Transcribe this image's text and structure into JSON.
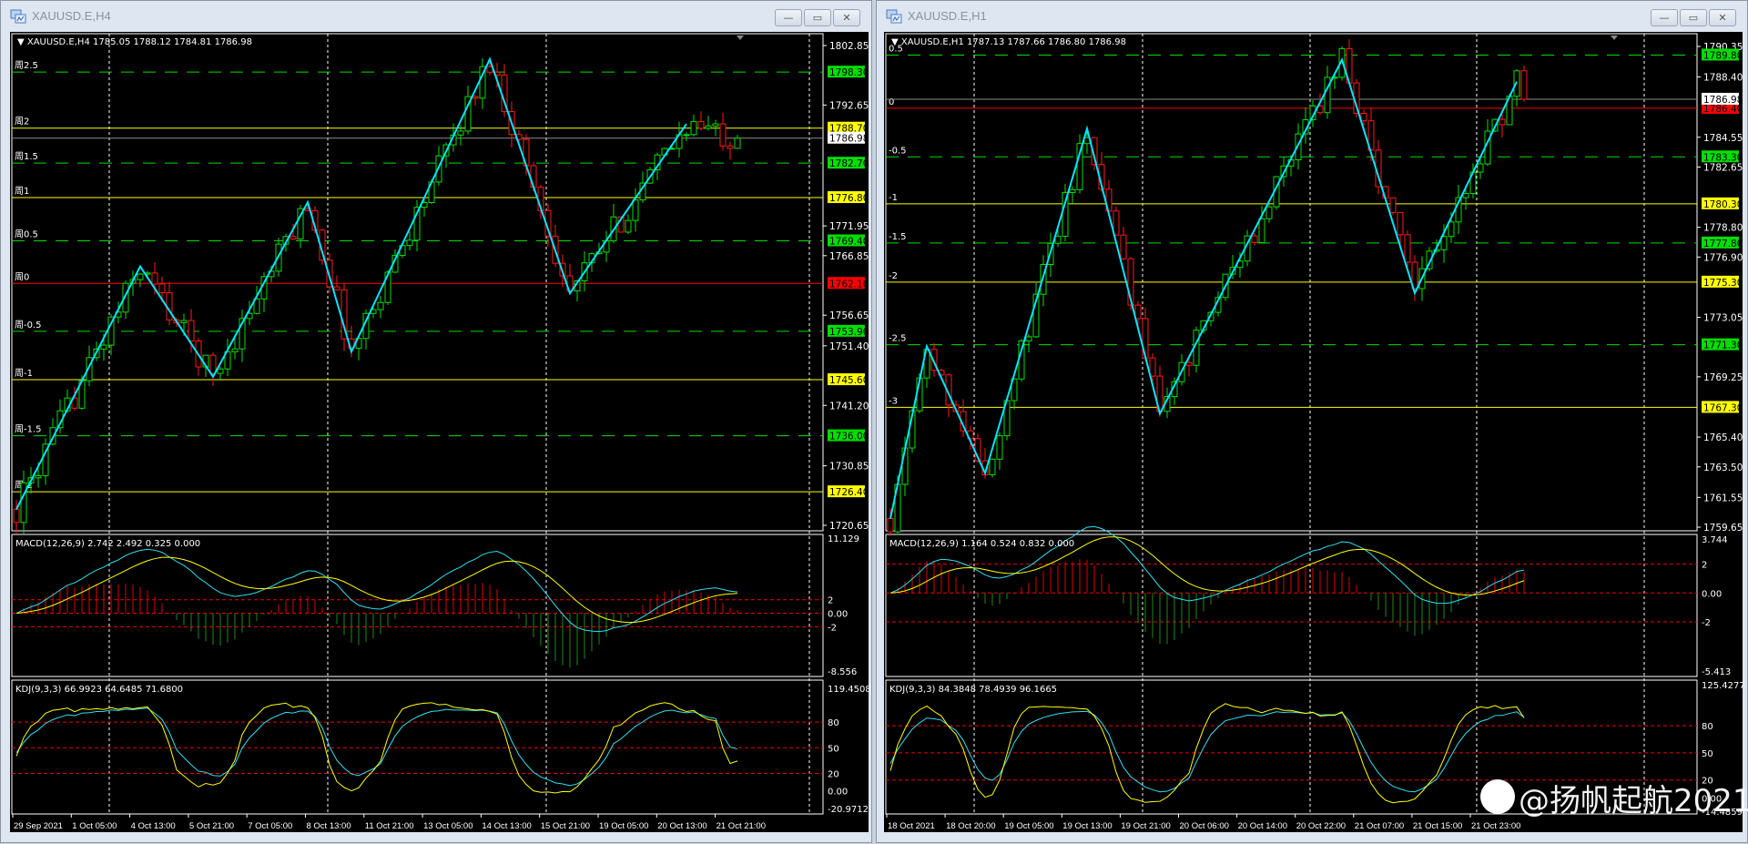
{
  "windows": [
    {
      "title": "XAUUSD.E,H4",
      "header": "XAUUSD.E,H4  1785.05 1788.12 1784.81 1786.98",
      "buttons": {
        "minimize": "—",
        "restore": "▭",
        "close": "✕"
      },
      "price_ticks": [
        "1802.85",
        "1792.65",
        "1771.95",
        "1766.85",
        "1756.65",
        "1751.40",
        "1741.20",
        "1730.85",
        "1720.65"
      ],
      "price_range": [
        1720.65,
        1802.85
      ],
      "current_price": "1786.98",
      "levels": [
        {
          "label": "周2.5",
          "price": "1798.30",
          "kind": "green"
        },
        {
          "label": "周2",
          "price": "1788.70",
          "kind": "yellow"
        },
        {
          "label": "周1.5",
          "price": "1782.70",
          "kind": "green"
        },
        {
          "label": "周1",
          "price": "1776.80",
          "kind": "yellow"
        },
        {
          "label": "周0.5",
          "price": "1769.40",
          "kind": "green"
        },
        {
          "label": "周0",
          "price": "1762.10",
          "kind": "red"
        },
        {
          "label": "周-0.5",
          "price": "1753.90",
          "kind": "green"
        },
        {
          "label": "周-1",
          "price": "1745.60",
          "kind": "yellow"
        },
        {
          "label": "周-1.5",
          "price": "1736.00",
          "kind": "green"
        },
        {
          "label": "周-2",
          "price": "1726.40",
          "kind": "yellow"
        }
      ],
      "bars": 100,
      "zigzag": [
        [
          0,
          1723.4
        ],
        [
          17,
          1765.0
        ],
        [
          27,
          1746.1
        ],
        [
          40,
          1776.0
        ],
        [
          46,
          1750.4
        ],
        [
          65,
          1800.5
        ],
        [
          76,
          1760.4
        ],
        [
          92,
          1789.4
        ],
        [
          99,
          1786.98
        ]
      ],
      "macd": {
        "header": "MACD(12,26,9) 2.742 2.492 0.325 0.000",
        "ticks": [
          "11.129",
          "2",
          "0.00",
          "-2",
          "-8.556"
        ],
        "range": [
          -8.556,
          11.129
        ]
      },
      "kdj": {
        "header": "KDJ(9,3,3) 66.9923 64.6485 71.6800",
        "ticks": [
          "119.4508",
          "80",
          "50",
          "20",
          "0.00",
          "-20.9712"
        ],
        "range": [
          -20.9712,
          119.4508
        ]
      },
      "time_labels": [
        "29 Sep 2021",
        "1 Oct 05:00",
        "4 Oct 13:00",
        "5 Oct 21:00",
        "7 Oct 05:00",
        "8 Oct 13:00",
        "11 Oct 21:00",
        "13 Oct 05:00",
        "14 Oct 13:00",
        "15 Oct 21:00",
        "19 Oct 05:00",
        "20 Oct 13:00",
        "21 Oct 21:00"
      ]
    },
    {
      "title": "XAUUSD.E,H1",
      "header": "XAUUSD.E,H1  1787.13 1787.66 1786.80 1786.98",
      "buttons": {
        "minimize": "—",
        "restore": "▭",
        "close": "✕"
      },
      "price_ticks": [
        "1790.35",
        "1788.40",
        "1784.55",
        "1782.65",
        "1778.80",
        "1776.90",
        "1773.05",
        "1769.25",
        "1765.40",
        "1763.50",
        "1761.55",
        "1759.65"
      ],
      "price_range": [
        1759.65,
        1790.35
      ],
      "current_price": "1786.98",
      "levels": [
        {
          "label": "0.5",
          "price": "1789.80",
          "kind": "green"
        },
        {
          "label": "0",
          "price": "1786.40",
          "kind": "red"
        },
        {
          "label": "-0.5",
          "price": "1783.30",
          "kind": "green"
        },
        {
          "label": "-1",
          "price": "1780.30",
          "kind": "yellow"
        },
        {
          "label": "-1.5",
          "price": "1777.80",
          "kind": "green"
        },
        {
          "label": "-2",
          "price": "1775.30",
          "kind": "yellow"
        },
        {
          "label": "-2.5",
          "price": "1771.30",
          "kind": "green"
        },
        {
          "label": "-3",
          "price": "1767.30",
          "kind": "yellow"
        }
      ],
      "bars": 88,
      "zigzag": [
        [
          0,
          1760.2
        ],
        [
          5,
          1771.2
        ],
        [
          13,
          1763.1
        ],
        [
          27,
          1785.1
        ],
        [
          37,
          1766.9
        ],
        [
          62,
          1789.5
        ],
        [
          72,
          1774.6
        ],
        [
          86,
          1788.1
        ],
        [
          87,
          1786.98
        ]
      ],
      "macd": {
        "header": "MACD(12,26,9) 1.164 0.524 0.832 0.000",
        "ticks": [
          "3.744",
          "2",
          "0.00",
          "-2",
          "-5.413"
        ],
        "range": [
          -5.413,
          3.744
        ]
      },
      "kdj": {
        "header": "KDJ(9,3,3) 84.3848 78.4939 96.1665",
        "ticks": [
          "125.4277",
          "80",
          "50",
          "20",
          "0.00",
          "-14.4859"
        ],
        "range": [
          -14.4859,
          125.4277
        ]
      },
      "time_labels": [
        "18 Oct 2021",
        "18 Oct 20:00",
        "19 Oct 05:00",
        "19 Oct 13:00",
        "19 Oct 21:00",
        "20 Oct 06:00",
        "20 Oct 14:00",
        "20 Oct 22:00",
        "21 Oct 07:00",
        "21 Oct 15:00",
        "21 Oct 23:00"
      ]
    }
  ],
  "colors": {
    "bull": "#00e000",
    "bear": "#ff1a1a",
    "zigzag": "#00e5ff",
    "green_level": "#00dd00",
    "yellow_level": "#ffff00",
    "red_level": "#ff0000",
    "dif": "#30e0f0",
    "dea": "#ffff00"
  },
  "watermark": "@扬帆起航2021"
}
